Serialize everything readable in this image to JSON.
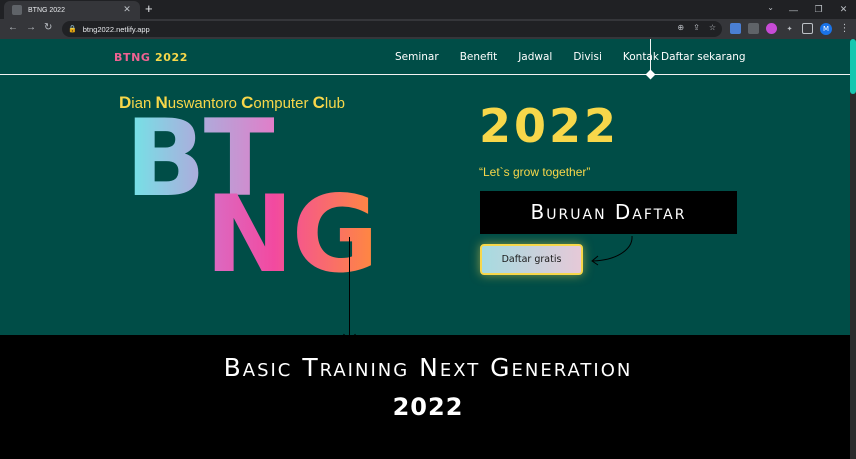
{
  "browser": {
    "tab_title": "BTNG 2022",
    "tab_close": "✕",
    "new_tab": "+",
    "url": "btng2022.netlify.app",
    "profile_initial": "M"
  },
  "site": {
    "logo_part1": "BTNG",
    "logo_part2": " 2022",
    "menu": [
      "Seminar",
      "Benefit",
      "Jadwal",
      "Divisi",
      "Kontak"
    ],
    "cta_nav": "Daftar sekarang"
  },
  "hero": {
    "club_words": [
      {
        "cap": "D",
        "rest": "ian "
      },
      {
        "cap": "N",
        "rest": "uswantoro "
      },
      {
        "cap": "C",
        "rest": "omputer "
      },
      {
        "cap": "C",
        "rest": "lub"
      }
    ],
    "big_line1": "BT",
    "big_line2": "NG",
    "year": "2022",
    "tagline": "“Let`s grow together”",
    "buruan_label": "Buruan Daftar",
    "button_label": "Daftar gratis"
  },
  "band": {
    "title": "Basic Training Next Generation",
    "year": "2022"
  },
  "colors": {
    "page_bg": "#004d47",
    "accent_yellow": "#f7d74a",
    "accent_pink": "#f06292",
    "band_bg": "#000000"
  }
}
